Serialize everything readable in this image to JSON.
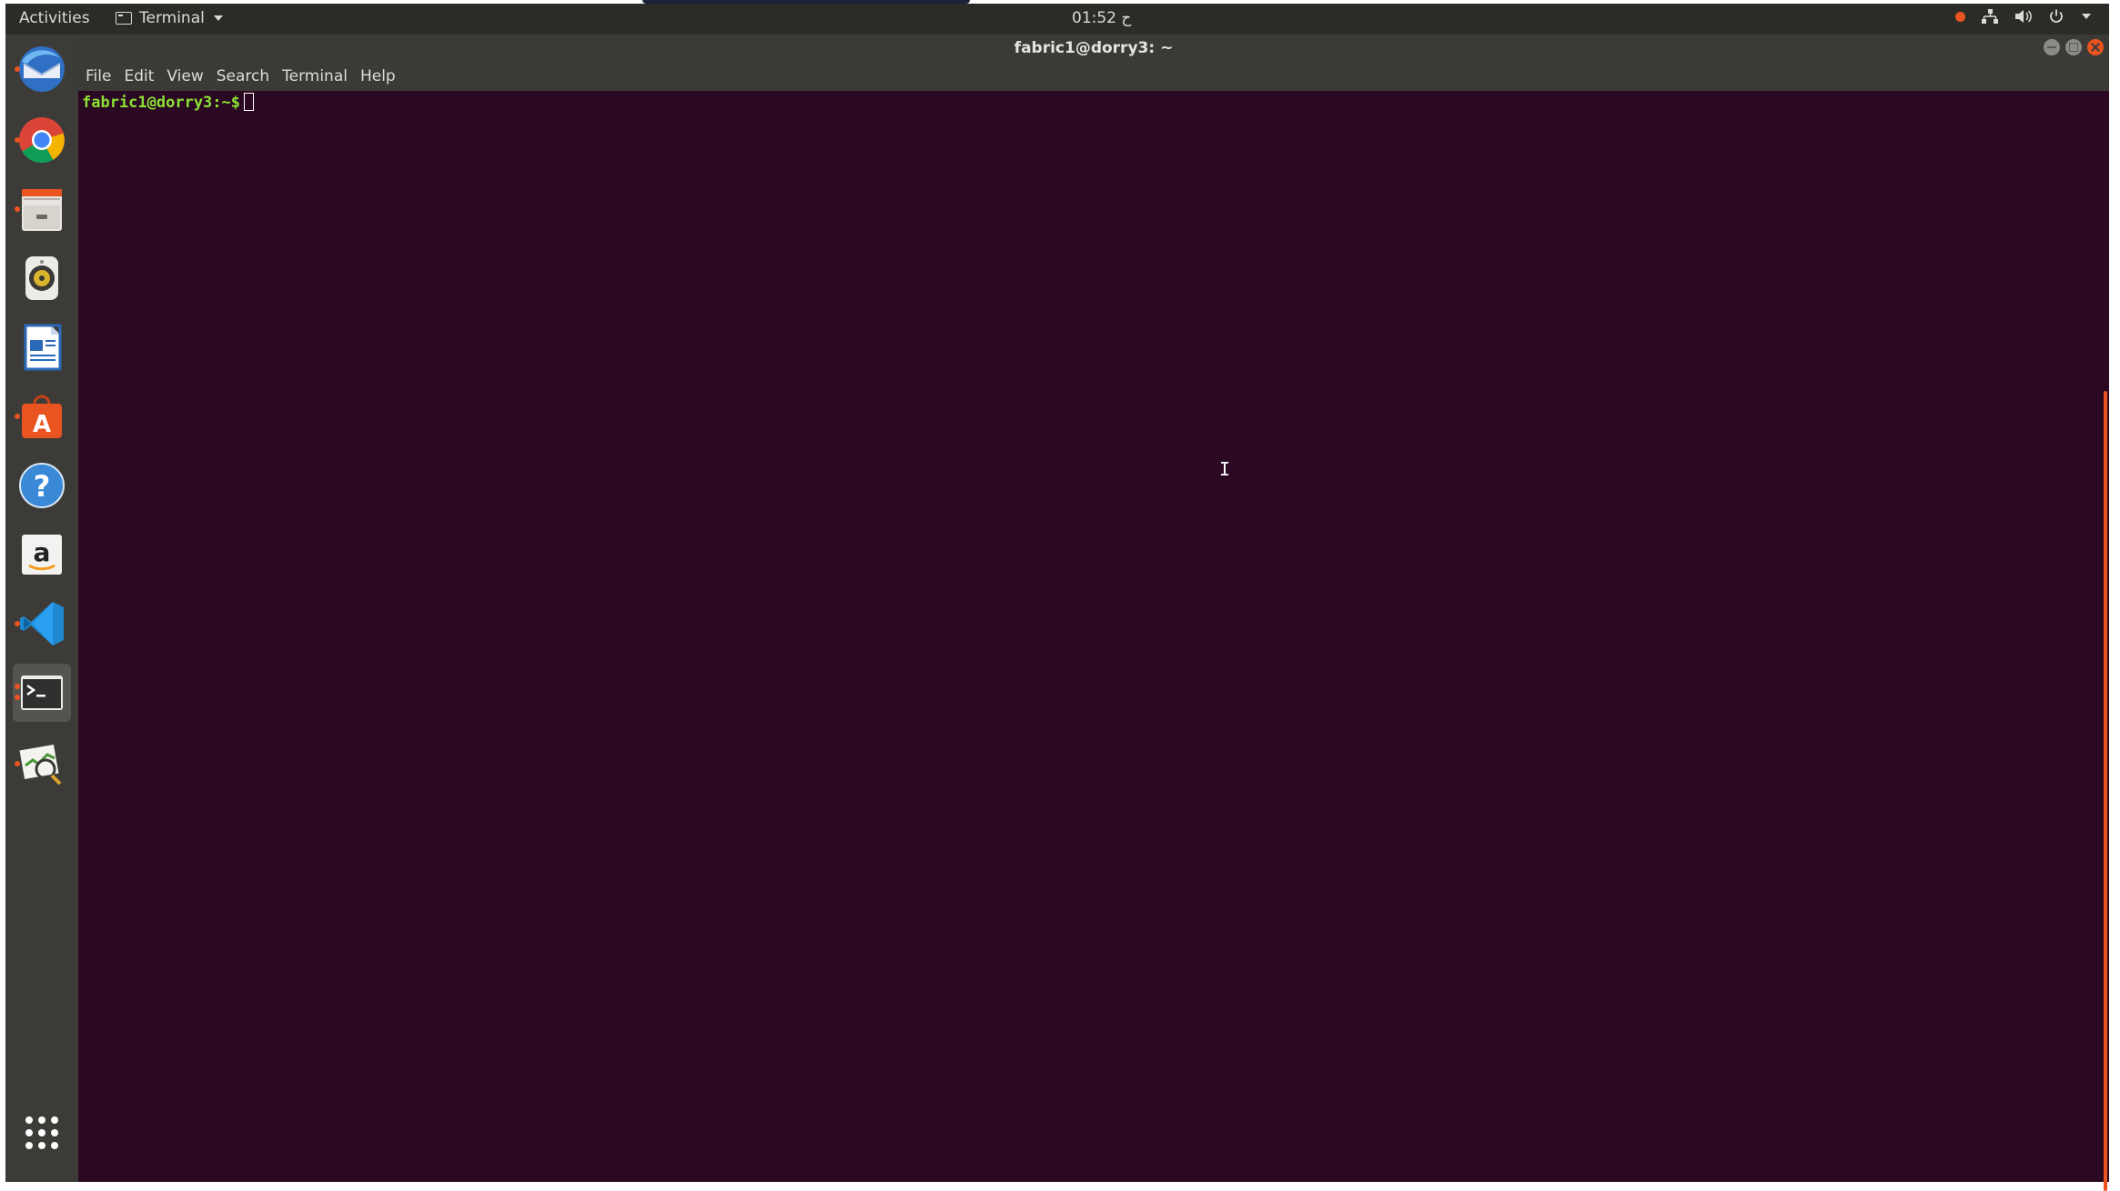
{
  "topbar": {
    "activities": "Activities",
    "app_name": "Terminal",
    "clock": "01:52 ح"
  },
  "window": {
    "title": "fabric1@dorry3: ~"
  },
  "menu": [
    "File",
    "Edit",
    "View",
    "Search",
    "Terminal",
    "Help"
  ],
  "terminal": {
    "prompt": "fabric1@dorry3:~$"
  },
  "dock": [
    {
      "name": "thunderbird-icon",
      "running": true
    },
    {
      "name": "chrome-icon",
      "running": true
    },
    {
      "name": "files-icon",
      "running": true
    },
    {
      "name": "rhythmbox-icon",
      "running": false
    },
    {
      "name": "writer-icon",
      "running": false
    },
    {
      "name": "software-center-icon",
      "running": true
    },
    {
      "name": "help-icon",
      "running": false
    },
    {
      "name": "amazon-icon",
      "running": false
    },
    {
      "name": "vscode-icon",
      "running": true
    },
    {
      "name": "terminal-icon",
      "running": true
    },
    {
      "name": "system-monitor-icon",
      "running": true
    },
    {
      "name": "show-apps-icon",
      "running": false
    }
  ],
  "colors": {
    "terminal_bg": "#2c0922",
    "prompt": "#8ae234",
    "accent": "#e95420"
  }
}
